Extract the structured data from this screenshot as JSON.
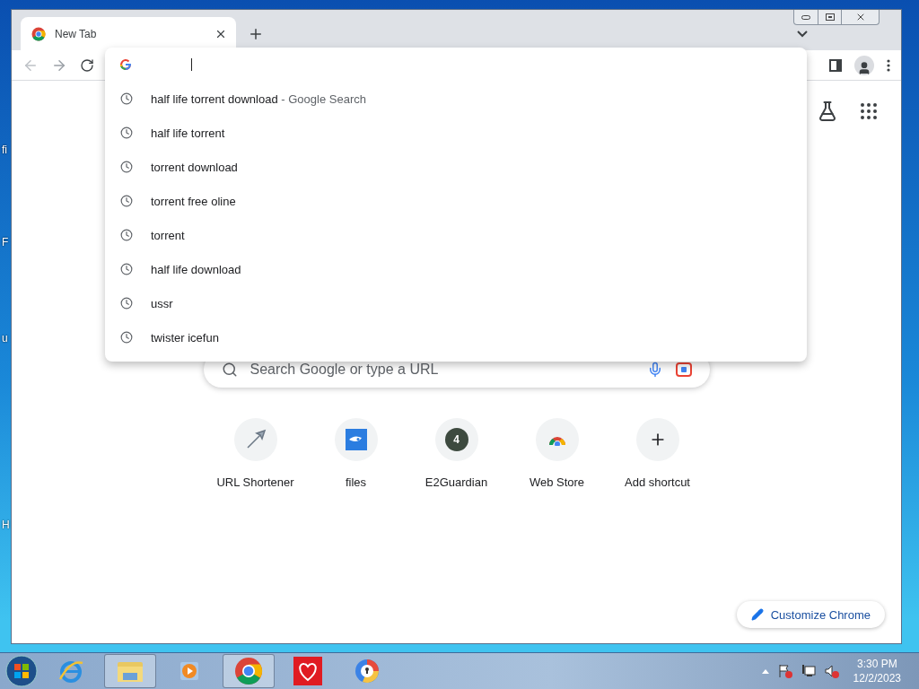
{
  "desktop": {
    "icon_labels": [
      "fi",
      "F",
      "u",
      "H"
    ]
  },
  "browser": {
    "tabs": [
      {
        "title": "New Tab",
        "selected": true
      }
    ],
    "omnibox": {
      "suggestions": [
        {
          "text": "half life torrent download",
          "detail": "- Google Search"
        },
        {
          "text": "half life torrent"
        },
        {
          "text": "torrent download"
        },
        {
          "text": "torrent free oline"
        },
        {
          "text": "torrent"
        },
        {
          "text": "half life download"
        },
        {
          "text": "ussr"
        },
        {
          "text": "twister icefun"
        }
      ]
    },
    "new_tab_page": {
      "search": {
        "placeholder": "Search Google or type a URL"
      },
      "shortcuts": [
        {
          "label": "URL Shortener",
          "kind": "arrow"
        },
        {
          "label": "files",
          "kind": "files"
        },
        {
          "label": "E2Guardian",
          "kind": "badge",
          "badge": "4"
        },
        {
          "label": "Web Store",
          "kind": "store"
        },
        {
          "label": "Add shortcut",
          "kind": "add"
        }
      ],
      "customize_button": "Customize Chrome"
    }
  },
  "taskbar": {
    "apps": [
      {
        "kind": "ie",
        "selected": false
      },
      {
        "kind": "folder",
        "selected": true
      },
      {
        "kind": "media",
        "selected": false
      },
      {
        "kind": "chrome",
        "selected": true
      },
      {
        "kind": "heart",
        "selected": false
      },
      {
        "kind": "shield",
        "selected": false
      }
    ],
    "clock": {
      "time": "3:30 PM",
      "date": "12/2/2023"
    }
  }
}
